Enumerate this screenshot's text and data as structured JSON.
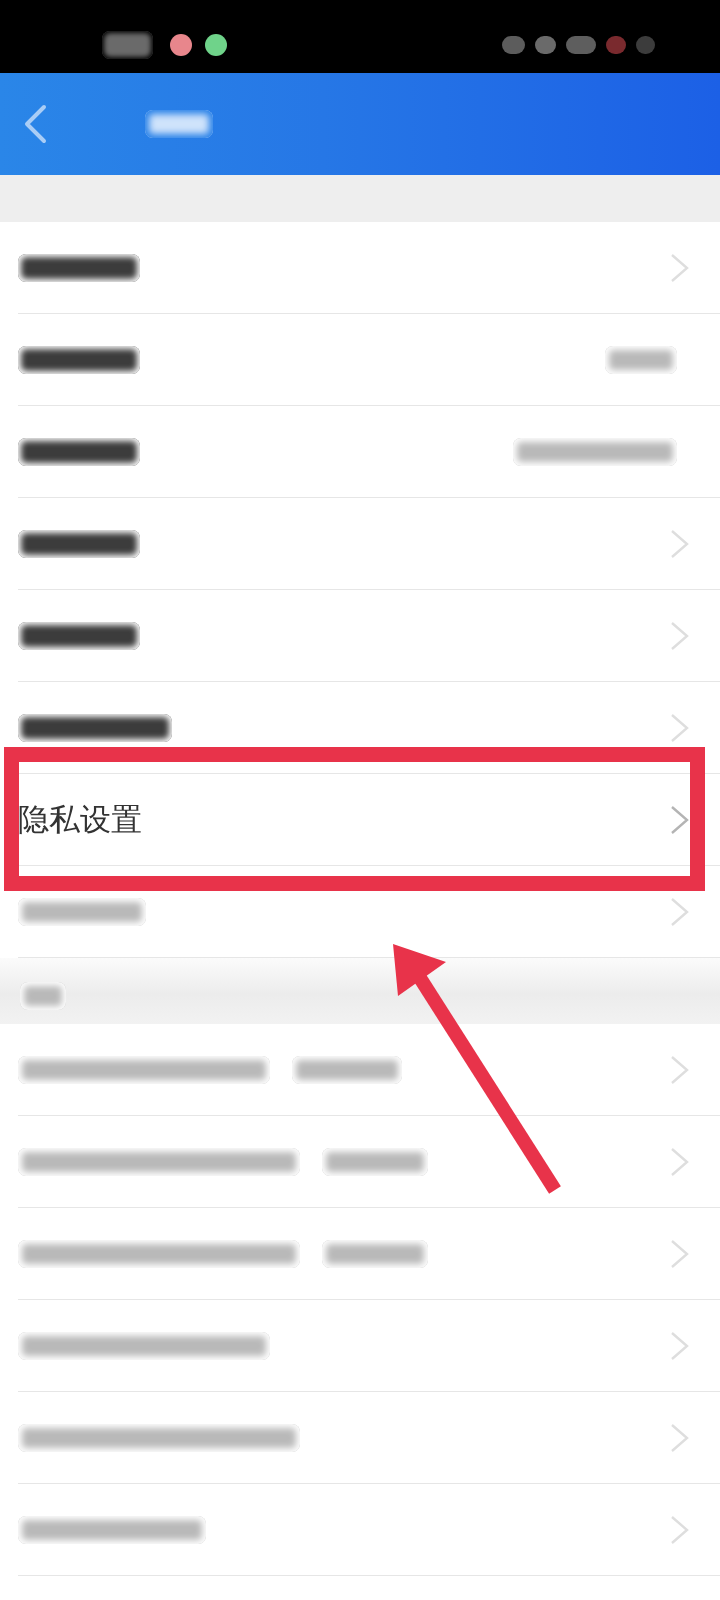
{
  "status_bar": {
    "time_blurred": true,
    "dots": [
      {
        "color": "#e8868c"
      },
      {
        "color": "#6fd38a"
      }
    ],
    "icons": [
      {
        "color": "#5c5c5c"
      },
      {
        "color": "#6a6a6a"
      },
      {
        "color": "#5e5e5e"
      },
      {
        "color": "#7a2a2e"
      },
      {
        "color": "#3c3c3c"
      }
    ]
  },
  "header": {
    "back_button": true,
    "title_blurred": true
  },
  "sections": [
    {
      "title_blurred": false,
      "rows": [
        {
          "kind": "blurred",
          "detail": false,
          "chevron": true,
          "highlighted": false
        },
        {
          "kind": "blurred",
          "detail": true,
          "chevron": false,
          "highlighted": false
        },
        {
          "kind": "blurred",
          "detail": true,
          "chevron": false,
          "highlighted": false
        },
        {
          "kind": "blurred",
          "detail": false,
          "chevron": true,
          "highlighted": false
        },
        {
          "kind": "blurred",
          "detail": false,
          "chevron": true,
          "highlighted": false
        },
        {
          "kind": "blurred",
          "detail": false,
          "chevron": true,
          "highlighted": false
        },
        {
          "kind": "text",
          "label": "隐私设置",
          "chevron": true,
          "highlighted": true
        },
        {
          "kind": "blurred",
          "detail": false,
          "chevron": true,
          "highlighted": false
        }
      ]
    },
    {
      "title_blurred": true,
      "rows": [
        {
          "kind": "blurred",
          "detail": false,
          "chevron": true,
          "highlighted": false
        },
        {
          "kind": "blurred",
          "detail": false,
          "chevron": true,
          "highlighted": false
        },
        {
          "kind": "blurred",
          "detail": false,
          "chevron": true,
          "highlighted": false
        },
        {
          "kind": "blurred",
          "detail": false,
          "chevron": true,
          "highlighted": false
        },
        {
          "kind": "blurred",
          "detail": false,
          "chevron": true,
          "highlighted": false
        },
        {
          "kind": "blurred",
          "detail": false,
          "chevron": true,
          "highlighted": false
        }
      ]
    }
  ],
  "pointer_arrow": true
}
